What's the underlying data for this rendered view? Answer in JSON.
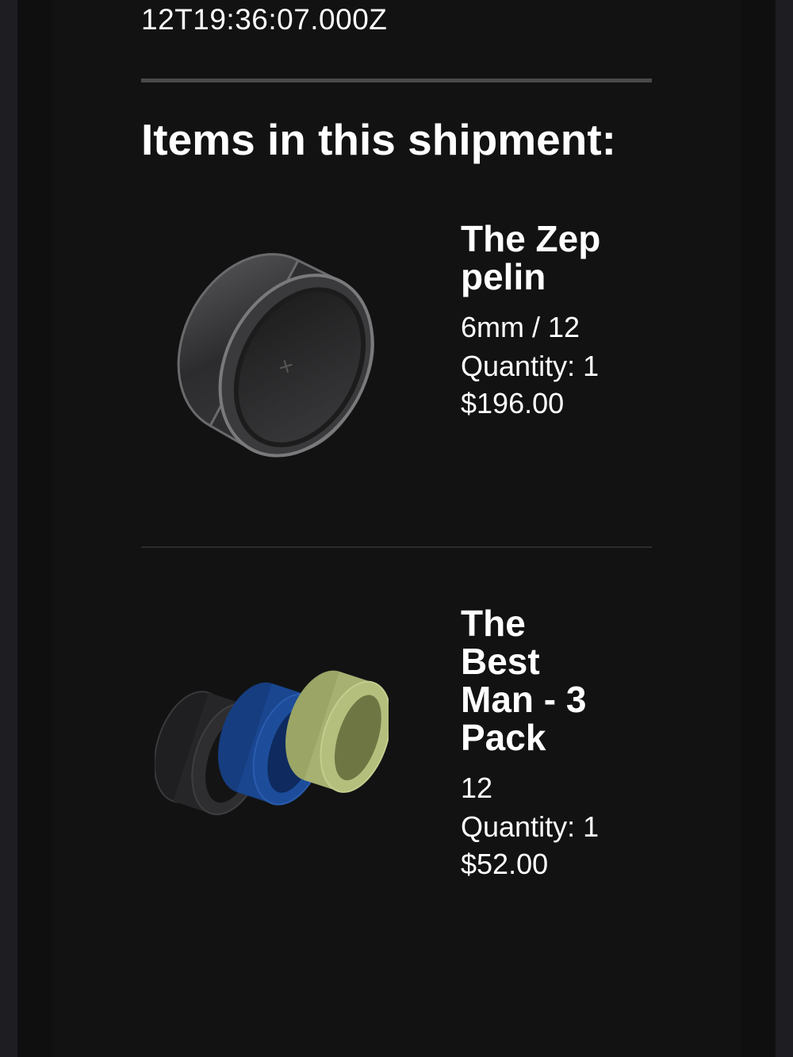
{
  "timestamp_fragment": "12T19:36:07.000Z",
  "shipment": {
    "title": "Items in this shipment:",
    "items": [
      {
        "name": "The Zeppelin",
        "variant": "6mm / 12",
        "quantity": "Quantity: 1",
        "price": "$196.00",
        "image_icon": "black-tungsten-ring-icon"
      },
      {
        "name": "The Best Man - 3 Pack",
        "variant": "12",
        "quantity": "Quantity: 1",
        "price": "$52.00",
        "image_icon": "three-silicone-rings-icon"
      }
    ]
  },
  "colors": {
    "background": "#121213",
    "text": "#ffffff",
    "ring_black": "#2a2a2c",
    "ring_blue": "#1d4d9a",
    "ring_green": "#b5bf7d"
  }
}
